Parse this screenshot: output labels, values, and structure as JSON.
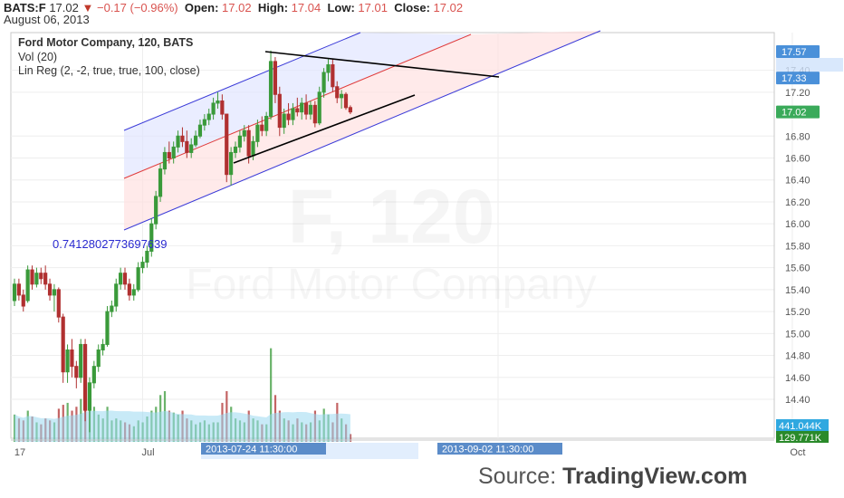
{
  "header": {
    "symbol": "BATS:F",
    "last": "17.02",
    "change": "−0.17 (−0.96%)",
    "open_label": "Open:",
    "open": "17.02",
    "high_label": "High:",
    "high": "17.04",
    "low_label": "Low:",
    "low": "17.01",
    "close_label": "Close:",
    "close": "17.02",
    "date": "August 06, 2013"
  },
  "legend": {
    "title": "Ford Motor Company, 120, BATS",
    "vol": "Vol (20)",
    "linreg": "Lin Reg (2, -2, true, true, 100, close)"
  },
  "correlation_label": "0.741280277369763​9",
  "watermark": {
    "line1": "F, 120",
    "line2": "Ford Motor Company"
  },
  "source": {
    "prefix": "Source: ",
    "brand": "TradingView.com"
  },
  "colors": {
    "up": "#3a9a3a",
    "down": "#b03030",
    "channel_line": "#3a3ad8",
    "mid_line": "#e03a3a",
    "vol_ma": "#9ad8f0"
  },
  "chart_data": {
    "type": "candlestick",
    "ylim": [
      14.0,
      17.6
    ],
    "y_ticks": [
      "17.57",
      "17.40",
      "17.33",
      "17.20",
      "17.02",
      "16.80",
      "16.60",
      "16.40",
      "16.20",
      "16.00",
      "15.80",
      "15.60",
      "15.40",
      "15.20",
      "15.00",
      "14.80",
      "14.60",
      "14.40"
    ],
    "y_tick_values": [
      17.57,
      17.4,
      17.33,
      17.2,
      17.02,
      16.8,
      16.6,
      16.4,
      16.2,
      16.0,
      15.8,
      15.6,
      15.4,
      15.2,
      15.0,
      14.8,
      14.6,
      14.4
    ],
    "highlighted_prices": [
      {
        "label": "17.57",
        "value": 17.57,
        "color": "#4a90d9"
      },
      {
        "label": "17.33",
        "value": 17.33,
        "color": "#4a90d9"
      },
      {
        "label": "17.02",
        "value": 17.02,
        "color": "#3aaa5a"
      }
    ],
    "volume_labels": [
      {
        "label": "441.044K",
        "color": "#2fa8e0"
      },
      {
        "label": "129.771K",
        "color": "#2a8a2a"
      }
    ],
    "x_ticks": [
      {
        "label": "17",
        "bar": 0
      },
      {
        "label": "Jul",
        "bar": 29
      },
      {
        "label": "Oct",
        "bar": 176
      }
    ],
    "time_labels": [
      "2013-07-24 11:30:00",
      "2013-09-02 11:30:00"
    ],
    "bars": [
      {
        "o": 15.3,
        "h": 15.5,
        "l": 15.25,
        "c": 15.45,
        "v": 70
      },
      {
        "o": 15.45,
        "h": 15.5,
        "l": 15.3,
        "c": 15.35,
        "v": 60
      },
      {
        "o": 15.35,
        "h": 15.4,
        "l": 15.2,
        "c": 15.25,
        "v": 55
      },
      {
        "o": 15.3,
        "h": 15.62,
        "l": 15.28,
        "c": 15.58,
        "v": 80
      },
      {
        "o": 15.58,
        "h": 15.62,
        "l": 15.4,
        "c": 15.45,
        "v": 65
      },
      {
        "o": 15.45,
        "h": 15.6,
        "l": 15.42,
        "c": 15.55,
        "v": 50
      },
      {
        "o": 15.55,
        "h": 15.6,
        "l": 15.45,
        "c": 15.5,
        "v": 45
      },
      {
        "o": 15.55,
        "h": 15.62,
        "l": 15.4,
        "c": 15.45,
        "v": 60
      },
      {
        "o": 15.45,
        "h": 15.5,
        "l": 15.3,
        "c": 15.35,
        "v": 55
      },
      {
        "o": 15.35,
        "h": 15.45,
        "l": 15.2,
        "c": 15.4,
        "v": 50
      },
      {
        "o": 15.4,
        "h": 15.42,
        "l": 15.1,
        "c": 15.15,
        "v": 85
      },
      {
        "o": 15.15,
        "h": 15.18,
        "l": 14.55,
        "c": 14.65,
        "v": 95
      },
      {
        "o": 14.65,
        "h": 14.9,
        "l": 14.55,
        "c": 14.85,
        "v": 100
      },
      {
        "o": 14.85,
        "h": 14.95,
        "l": 14.6,
        "c": 14.7,
        "v": 80
      },
      {
        "o": 14.7,
        "h": 14.75,
        "l": 14.5,
        "c": 14.6,
        "v": 90
      },
      {
        "o": 14.6,
        "h": 14.95,
        "l": 14.55,
        "c": 14.9,
        "v": 110
      },
      {
        "o": 14.9,
        "h": 14.95,
        "l": 14.2,
        "c": 14.3,
        "v": 150
      },
      {
        "o": 14.3,
        "h": 14.6,
        "l": 14.1,
        "c": 14.55,
        "v": 120
      },
      {
        "o": 14.55,
        "h": 14.75,
        "l": 14.5,
        "c": 14.7,
        "v": 90
      },
      {
        "o": 14.7,
        "h": 14.9,
        "l": 14.65,
        "c": 14.85,
        "v": 70
      },
      {
        "o": 14.85,
        "h": 14.95,
        "l": 14.8,
        "c": 14.9,
        "v": 60
      },
      {
        "o": 14.9,
        "h": 15.25,
        "l": 14.88,
        "c": 15.2,
        "v": 90
      },
      {
        "o": 15.2,
        "h": 15.3,
        "l": 15.15,
        "c": 15.25,
        "v": 55
      },
      {
        "o": 15.25,
        "h": 15.5,
        "l": 15.2,
        "c": 15.45,
        "v": 60
      },
      {
        "o": 15.45,
        "h": 15.6,
        "l": 15.4,
        "c": 15.55,
        "v": 55
      },
      {
        "o": 15.55,
        "h": 15.6,
        "l": 15.4,
        "c": 15.45,
        "v": 50
      },
      {
        "o": 15.45,
        "h": 15.5,
        "l": 15.3,
        "c": 15.35,
        "v": 45
      },
      {
        "o": 15.35,
        "h": 15.45,
        "l": 15.3,
        "c": 15.4,
        "v": 40
      },
      {
        "o": 15.4,
        "h": 15.65,
        "l": 15.38,
        "c": 15.6,
        "v": 55
      },
      {
        "o": 15.6,
        "h": 15.7,
        "l": 15.55,
        "c": 15.65,
        "v": 50
      },
      {
        "o": 15.65,
        "h": 15.8,
        "l": 15.6,
        "c": 15.75,
        "v": 65
      },
      {
        "o": 15.75,
        "h": 16.05,
        "l": 15.7,
        "c": 16.0,
        "v": 80
      },
      {
        "o": 16.0,
        "h": 16.3,
        "l": 15.95,
        "c": 16.25,
        "v": 90
      },
      {
        "o": 16.25,
        "h": 16.55,
        "l": 16.2,
        "c": 16.5,
        "v": 120
      },
      {
        "o": 16.5,
        "h": 16.7,
        "l": 16.45,
        "c": 16.65,
        "v": 130
      },
      {
        "o": 16.65,
        "h": 16.75,
        "l": 16.55,
        "c": 16.6,
        "v": 80
      },
      {
        "o": 16.6,
        "h": 16.75,
        "l": 16.55,
        "c": 16.7,
        "v": 75
      },
      {
        "o": 16.7,
        "h": 16.85,
        "l": 16.65,
        "c": 16.8,
        "v": 70
      },
      {
        "o": 16.8,
        "h": 16.88,
        "l": 16.7,
        "c": 16.75,
        "v": 80
      },
      {
        "o": 16.75,
        "h": 16.85,
        "l": 16.6,
        "c": 16.65,
        "v": 60
      },
      {
        "o": 16.65,
        "h": 16.78,
        "l": 16.6,
        "c": 16.72,
        "v": 55
      },
      {
        "o": 16.72,
        "h": 16.85,
        "l": 16.7,
        "c": 16.8,
        "v": 45
      },
      {
        "o": 16.8,
        "h": 16.95,
        "l": 16.78,
        "c": 16.9,
        "v": 50
      },
      {
        "o": 16.9,
        "h": 17.0,
        "l": 16.85,
        "c": 16.95,
        "v": 55
      },
      {
        "o": 16.95,
        "h": 17.05,
        "l": 16.9,
        "c": 17.0,
        "v": 45
      },
      {
        "o": 17.0,
        "h": 17.15,
        "l": 16.95,
        "c": 17.1,
        "v": 50
      },
      {
        "o": 17.1,
        "h": 17.2,
        "l": 17.05,
        "c": 17.12,
        "v": 50
      },
      {
        "o": 17.12,
        "h": 17.18,
        "l": 16.95,
        "c": 17.0,
        "v": 100
      },
      {
        "o": 17.0,
        "h": 16.92,
        "l": 16.38,
        "c": 16.45,
        "v": 130
      },
      {
        "o": 16.45,
        "h": 16.7,
        "l": 16.35,
        "c": 16.65,
        "v": 90
      },
      {
        "o": 16.65,
        "h": 16.75,
        "l": 16.6,
        "c": 16.7,
        "v": 60
      },
      {
        "o": 16.7,
        "h": 16.85,
        "l": 16.65,
        "c": 16.8,
        "v": 55
      },
      {
        "o": 16.8,
        "h": 16.9,
        "l": 16.75,
        "c": 16.85,
        "v": 50
      },
      {
        "o": 16.85,
        "h": 16.9,
        "l": 16.55,
        "c": 16.62,
        "v": 80
      },
      {
        "o": 16.62,
        "h": 16.8,
        "l": 16.58,
        "c": 16.75,
        "v": 60
      },
      {
        "o": 16.75,
        "h": 16.95,
        "l": 16.7,
        "c": 16.9,
        "v": 55
      },
      {
        "o": 16.9,
        "h": 16.98,
        "l": 16.8,
        "c": 16.85,
        "v": 45
      },
      {
        "o": 16.85,
        "h": 17.02,
        "l": 16.8,
        "c": 16.98,
        "v": 45
      },
      {
        "o": 16.98,
        "h": 17.58,
        "l": 16.95,
        "c": 17.48,
        "v": 240
      },
      {
        "o": 17.48,
        "h": 17.52,
        "l": 17.1,
        "c": 17.18,
        "v": 120
      },
      {
        "o": 17.18,
        "h": 17.25,
        "l": 16.8,
        "c": 16.88,
        "v": 80
      },
      {
        "o": 16.88,
        "h": 17.05,
        "l": 16.82,
        "c": 17.0,
        "v": 60
      },
      {
        "o": 17.0,
        "h": 17.1,
        "l": 16.9,
        "c": 16.95,
        "v": 55
      },
      {
        "o": 16.95,
        "h": 17.1,
        "l": 16.9,
        "c": 17.05,
        "v": 45
      },
      {
        "o": 17.05,
        "h": 17.15,
        "l": 16.98,
        "c": 17.02,
        "v": 60
      },
      {
        "o": 17.02,
        "h": 17.15,
        "l": 16.95,
        "c": 17.1,
        "v": 50
      },
      {
        "o": 17.1,
        "h": 17.18,
        "l": 16.95,
        "c": 17.0,
        "v": 45
      },
      {
        "o": 17.0,
        "h": 17.12,
        "l": 16.95,
        "c": 17.08,
        "v": 50
      },
      {
        "o": 17.08,
        "h": 17.12,
        "l": 16.88,
        "c": 16.92,
        "v": 80
      },
      {
        "o": 16.92,
        "h": 17.25,
        "l": 16.9,
        "c": 17.2,
        "v": 55
      },
      {
        "o": 17.2,
        "h": 17.42,
        "l": 17.15,
        "c": 17.38,
        "v": 85
      },
      {
        "o": 17.38,
        "h": 17.5,
        "l": 17.3,
        "c": 17.45,
        "v": 70
      },
      {
        "o": 17.45,
        "h": 17.5,
        "l": 17.2,
        "c": 17.25,
        "v": 50
      },
      {
        "o": 17.25,
        "h": 17.3,
        "l": 17.1,
        "c": 17.15,
        "v": 100
      },
      {
        "o": 17.15,
        "h": 17.22,
        "l": 17.05,
        "c": 17.18,
        "v": 60
      },
      {
        "o": 17.18,
        "h": 17.2,
        "l": 17.04,
        "c": 17.06,
        "v": 45
      },
      {
        "o": 17.06,
        "h": 17.08,
        "l": 17.0,
        "c": 17.02,
        "v": 20
      }
    ]
  }
}
